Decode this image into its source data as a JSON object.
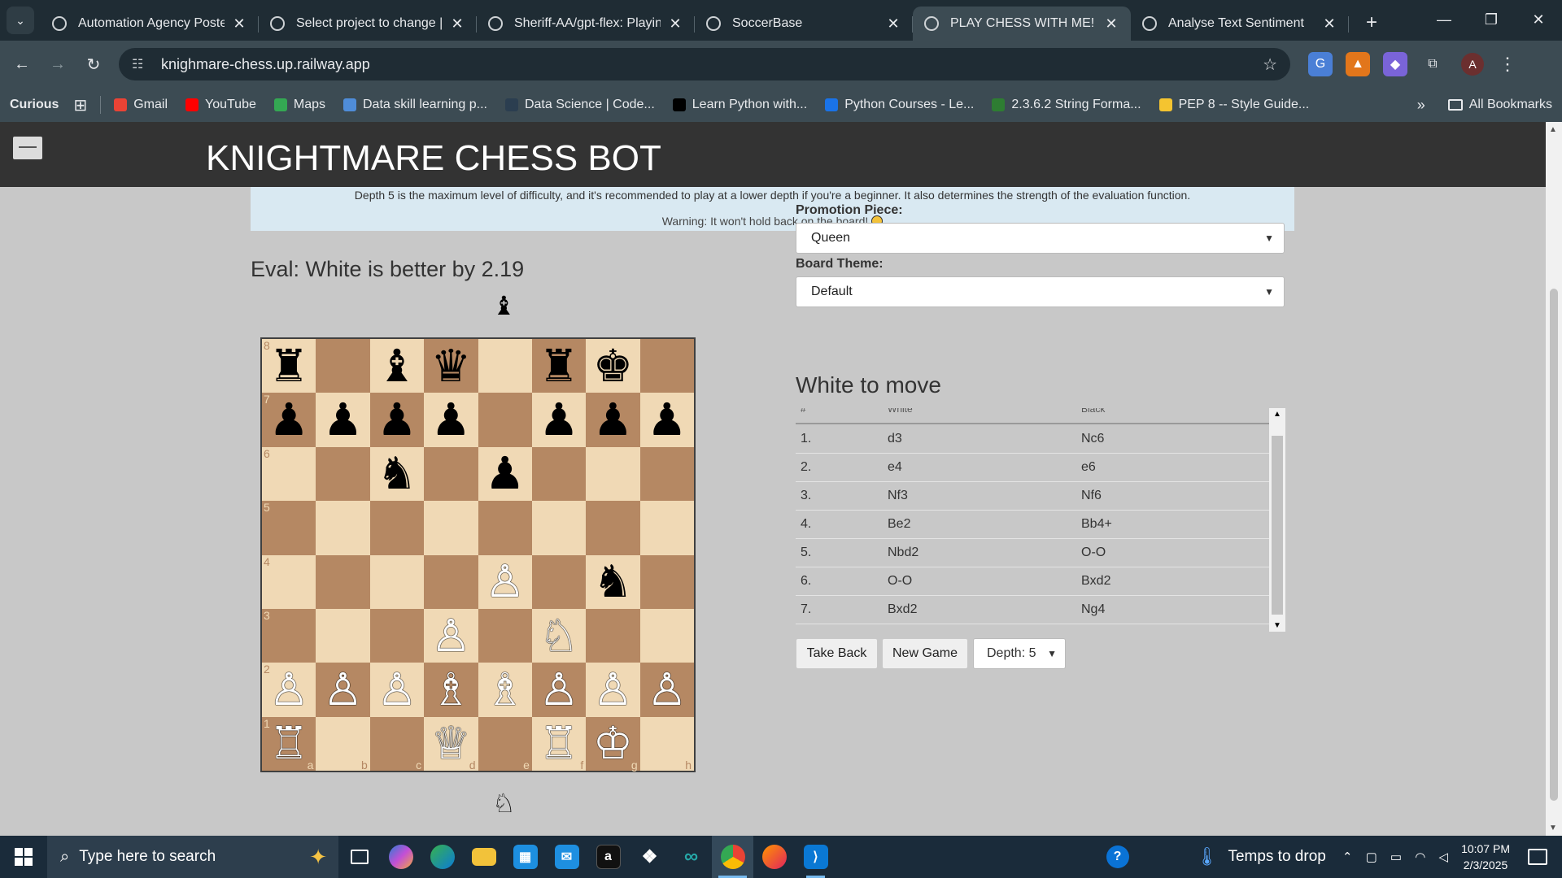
{
  "browser": {
    "tabs": [
      {
        "title": "Automation Agency Poster",
        "active": false
      },
      {
        "title": "Select project to change | D",
        "active": false
      },
      {
        "title": "Sheriff-AA/gpt-flex: Playing",
        "active": false
      },
      {
        "title": "SoccerBase",
        "active": false
      },
      {
        "title": "PLAY CHESS WITH ME!",
        "active": true
      },
      {
        "title": "Analyse Text Sentiment",
        "active": false
      }
    ],
    "url": "knighmare-chess.up.railway.app",
    "profile_initial": "A",
    "bookmarks": {
      "curious": "Curious",
      "items": [
        {
          "label": "Gmail",
          "color": "#ea4335"
        },
        {
          "label": "YouTube",
          "color": "#ff0000"
        },
        {
          "label": "Maps",
          "color": "#34a853"
        },
        {
          "label": "Data skill learning p...",
          "color": "#4f8dd9"
        },
        {
          "label": "Data Science | Code...",
          "color": "#2b3e50"
        },
        {
          "label": "Learn Python with...",
          "color": "#000000"
        },
        {
          "label": "Python Courses - Le...",
          "color": "#1a73e8"
        },
        {
          "label": "2.3.6.2 String Forma...",
          "color": "#2e7d32"
        },
        {
          "label": "PEP 8 -- Style Guide...",
          "color": "#f4c430"
        }
      ],
      "all_bookmarks": "All Bookmarks"
    }
  },
  "app": {
    "title": "KNIGHTMARE CHESS BOT",
    "banner_line1": "Depth 5 is the maximum level of difficulty, and it's recommended to play at a lower depth if you're a beginner. It also determines the strength of the evaluation function.",
    "banner_line2": "Warning: It won't hold back on the board!",
    "eval": "Eval: White is better by 2.19",
    "top_indicator": "♝",
    "bottom_indicator": "♘",
    "promotion_label": "Promotion Piece:",
    "promotion_value": "Queen",
    "theme_label": "Board Theme:",
    "theme_value": "Default",
    "turn": "White to move",
    "moves_header": {
      "num": "#",
      "white": "White",
      "black": "Black"
    },
    "moves": [
      {
        "num": "1.",
        "white": "d3",
        "black": "Nc6"
      },
      {
        "num": "2.",
        "white": "e4",
        "black": "e6"
      },
      {
        "num": "3.",
        "white": "Nf3",
        "black": "Nf6"
      },
      {
        "num": "4.",
        "white": "Be2",
        "black": "Bb4+"
      },
      {
        "num": "5.",
        "white": "Nbd2",
        "black": "O-O"
      },
      {
        "num": "6.",
        "white": "O-O",
        "black": "Bxd2"
      },
      {
        "num": "7.",
        "white": "Bxd2",
        "black": "Ng4"
      }
    ],
    "buttons": {
      "take_back": "Take Back",
      "new_game": "New Game"
    },
    "depth": "Depth: 5"
  },
  "board": {
    "ranks": [
      "8",
      "7",
      "6",
      "5",
      "4",
      "3",
      "2",
      "1"
    ],
    "files": [
      "a",
      "b",
      "c",
      "d",
      "e",
      "f",
      "g",
      "h"
    ],
    "rows": [
      [
        "r",
        "",
        "b",
        "q",
        "",
        "r",
        "k",
        ""
      ],
      [
        "p",
        "p",
        "p",
        "p",
        "",
        "p",
        "p",
        "p"
      ],
      [
        "",
        "",
        "n",
        "",
        "p",
        "",
        "",
        ""
      ],
      [
        "",
        "",
        "",
        "",
        "",
        "",
        "",
        ""
      ],
      [
        "",
        "",
        "",
        "",
        "P",
        "",
        "n",
        ""
      ],
      [
        "",
        "",
        "",
        "P",
        "",
        "N",
        "",
        ""
      ],
      [
        "P",
        "P",
        "P",
        "B",
        "B",
        "P",
        "P",
        "P"
      ],
      [
        "R",
        "",
        "",
        "Q",
        "",
        "R",
        "K",
        ""
      ]
    ],
    "light_color": "#f0d9b5",
    "dark_color": "#b58863"
  },
  "taskbar": {
    "search_placeholder": "Type here to search",
    "weather": "Temps to drop",
    "time": "10:07 PM",
    "date": "2/3/2025"
  }
}
